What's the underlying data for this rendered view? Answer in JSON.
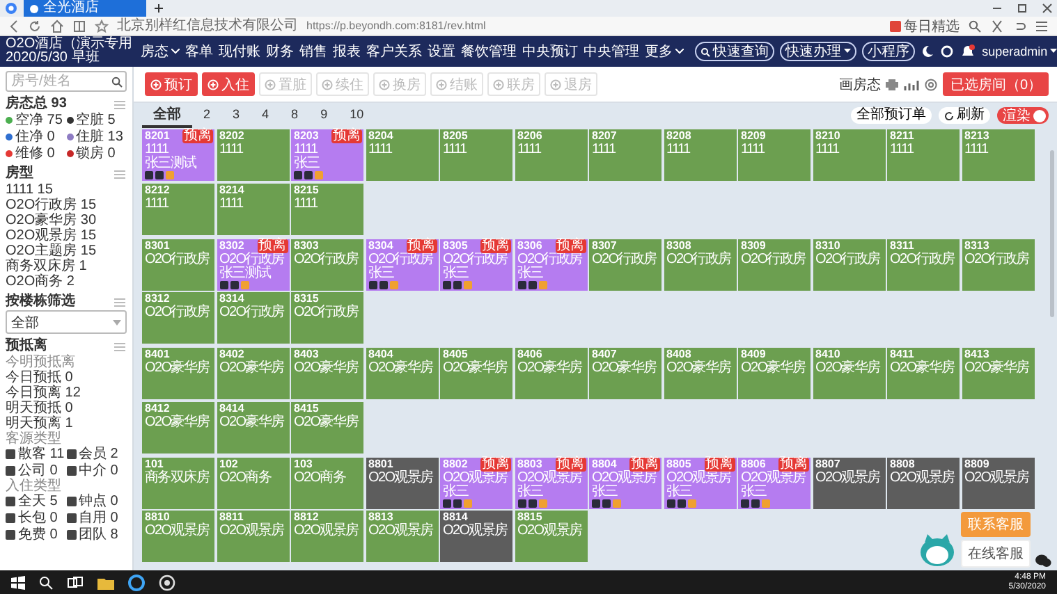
{
  "browser": {
    "tab_title": "全光酒店",
    "site_name": "北京别样红信息技术有限公司",
    "url": "https://p.beyondh.com:8181/rev.html",
    "extension_label": "每日精选"
  },
  "topbar": {
    "hotel_name": "O2O酒店（演示专用",
    "shift": "2020/5/30 早班",
    "menu": [
      {
        "label": "房态",
        "dropdown": true
      },
      {
        "label": "客单",
        "dropdown": false
      },
      {
        "label": "现付账",
        "dropdown": false
      },
      {
        "label": "财务",
        "dropdown": false
      },
      {
        "label": "销售",
        "dropdown": false
      },
      {
        "label": "报表",
        "dropdown": false
      },
      {
        "label": "客户关系",
        "dropdown": false
      },
      {
        "label": "设置",
        "dropdown": false
      },
      {
        "label": "餐饮管理",
        "dropdown": false
      },
      {
        "label": "中央预订",
        "dropdown": false
      },
      {
        "label": "中央管理",
        "dropdown": false
      },
      {
        "label": "更多",
        "dropdown": true
      }
    ],
    "quick": [
      {
        "label": "快速查询",
        "kind": "search"
      },
      {
        "label": "快速办理",
        "kind": "menu"
      },
      {
        "label": "小程序",
        "kind": "plain"
      }
    ],
    "user": "superadmin"
  },
  "sidebar": {
    "search": {
      "placeholder": "房号/姓名"
    },
    "sections": [
      {
        "kind": "status",
        "title": "房态总 93",
        "items": [
          {
            "label": "空净 75",
            "color": "#4caf50"
          },
          {
            "label": "空脏 5",
            "color": "#333333"
          },
          {
            "label": "住净 0",
            "color": "#2f6fd0"
          },
          {
            "label": "住脏 13",
            "color": "#8e7cc3"
          },
          {
            "label": "维修 0",
            "color": "#e53935"
          },
          {
            "label": "锁房 0",
            "color": "#c62828"
          }
        ]
      },
      {
        "kind": "list",
        "title": "房型",
        "items": [
          "1111 15",
          "O2O行政房 15",
          "O2O豪华房 30",
          "O2O观景房 15",
          "O2O主题房 15",
          "商务双床房 1",
          "O2O商务 2"
        ]
      },
      {
        "kind": "select",
        "title": "按楼栋筛选",
        "value": "全部"
      },
      {
        "kind": "groups",
        "title": "预抵离",
        "groups": [
          {
            "kind": "plain",
            "subtitle": "今明预抵离",
            "items": [
              "今日预抵 0",
              "今日预离 12",
              "明天预抵 0",
              "明天预离 1"
            ]
          },
          {
            "kind": "tagged",
            "subtitle": "客源类型",
            "items": [
              "散客 11",
              "会员 2",
              "公司 0",
              "中介 0"
            ]
          },
          {
            "kind": "tagged",
            "subtitle": "入住类型",
            "items": [
              "全天 5",
              "钟点 0",
              "长包 0",
              "自用 0",
              "免费 0",
              "团队 8"
            ]
          }
        ]
      }
    ]
  },
  "toolbar": {
    "buttons": [
      {
        "label": "预订",
        "kind": "primary",
        "disabled": false
      },
      {
        "label": "入住",
        "kind": "primary",
        "disabled": false
      },
      {
        "label": "置脏",
        "kind": "plain",
        "disabled": true
      },
      {
        "label": "续住",
        "kind": "plain",
        "disabled": true
      },
      {
        "label": "换房",
        "kind": "plain",
        "disabled": true
      },
      {
        "label": "结账",
        "kind": "plain",
        "disabled": true
      },
      {
        "label": "联房",
        "kind": "plain",
        "disabled": true
      },
      {
        "label": "退房",
        "kind": "plain",
        "disabled": true
      }
    ],
    "view_label": "画房态",
    "selected_button": "已选房间（0）"
  },
  "floor_tabs": [
    {
      "label": "全部",
      "selected": true
    },
    {
      "label": "2",
      "selected": false
    },
    {
      "label": "3",
      "selected": false
    },
    {
      "label": "4",
      "selected": false
    },
    {
      "label": "8",
      "selected": false
    },
    {
      "label": "9",
      "selected": false
    },
    {
      "label": "10",
      "selected": false
    }
  ],
  "view_options": {
    "expand_label": "全部预订单",
    "refresh_label": "刷新",
    "toggle": {
      "label": "渲染",
      "on": true
    }
  },
  "floors": [
    {
      "rows": [
        [
          {
            "number": "8201",
            "type": "1111",
            "kind": "occupied",
            "guest": "张三测试",
            "badge": "预离"
          },
          {
            "number": "8202",
            "type": "1111",
            "kind": "vacant"
          },
          {
            "number": "8203",
            "type": "1111",
            "kind": "occupied",
            "guest": "张三",
            "badge": "预离"
          },
          {
            "number": "8204",
            "type": "1111",
            "kind": "vacant"
          },
          {
            "number": "8205",
            "type": "1111",
            "kind": "vacant"
          },
          {
            "number": "8206",
            "type": "1111",
            "kind": "vacant"
          },
          {
            "number": "8207",
            "type": "1111",
            "kind": "vacant"
          },
          {
            "number": "8208",
            "type": "1111",
            "kind": "vacant"
          },
          {
            "number": "8209",
            "type": "1111",
            "kind": "vacant"
          },
          {
            "number": "8210",
            "type": "1111",
            "kind": "vacant"
          },
          {
            "number": "8211",
            "type": "1111",
            "kind": "vacant"
          },
          {
            "number": "8213",
            "type": "1111",
            "kind": "vacant"
          }
        ],
        [
          {
            "number": "8212",
            "type": "1111",
            "kind": "vacant"
          },
          {
            "number": "8214",
            "type": "1111",
            "kind": "vacant"
          },
          {
            "number": "8215",
            "type": "1111",
            "kind": "vacant"
          }
        ]
      ]
    },
    {
      "rows": [
        [
          {
            "number": "8301",
            "type": "O2O行政房",
            "kind": "vacant"
          },
          {
            "number": "8302",
            "type": "O2O行政房",
            "kind": "occupied",
            "guest": "张三测试",
            "badge": "预离"
          },
          {
            "number": "8303",
            "type": "O2O行政房",
            "kind": "vacant"
          },
          {
            "number": "8304",
            "type": "O2O行政房",
            "kind": "occupied",
            "guest": "张三",
            "badge": "预离"
          },
          {
            "number": "8305",
            "type": "O2O行政房",
            "kind": "occupied",
            "guest": "张三",
            "badge": "预离"
          },
          {
            "number": "8306",
            "type": "O2O行政房",
            "kind": "occupied",
            "guest": "张三",
            "badge": "预离"
          },
          {
            "number": "8307",
            "type": "O2O行政房",
            "kind": "vacant"
          },
          {
            "number": "8308",
            "type": "O2O行政房",
            "kind": "vacant"
          },
          {
            "number": "8309",
            "type": "O2O行政房",
            "kind": "vacant"
          },
          {
            "number": "8310",
            "type": "O2O行政房",
            "kind": "vacant"
          },
          {
            "number": "8311",
            "type": "O2O行政房",
            "kind": "vacant"
          },
          {
            "number": "8313",
            "type": "O2O行政房",
            "kind": "vacant"
          }
        ],
        [
          {
            "number": "8312",
            "type": "O2O行政房",
            "kind": "vacant"
          },
          {
            "number": "8314",
            "type": "O2O行政房",
            "kind": "vacant"
          },
          {
            "number": "8315",
            "type": "O2O行政房",
            "kind": "vacant"
          }
        ]
      ]
    },
    {
      "rows": [
        [
          {
            "number": "8401",
            "type": "O2O豪华房",
            "kind": "vacant"
          },
          {
            "number": "8402",
            "type": "O2O豪华房",
            "kind": "vacant"
          },
          {
            "number": "8403",
            "type": "O2O豪华房",
            "kind": "vacant"
          },
          {
            "number": "8404",
            "type": "O2O豪华房",
            "kind": "vacant"
          },
          {
            "number": "8405",
            "type": "O2O豪华房",
            "kind": "vacant"
          },
          {
            "number": "8406",
            "type": "O2O豪华房",
            "kind": "vacant"
          },
          {
            "number": "8407",
            "type": "O2O豪华房",
            "kind": "vacant"
          },
          {
            "number": "8408",
            "type": "O2O豪华房",
            "kind": "vacant"
          },
          {
            "number": "8409",
            "type": "O2O豪华房",
            "kind": "vacant"
          },
          {
            "number": "8410",
            "type": "O2O豪华房",
            "kind": "vacant"
          },
          {
            "number": "8411",
            "type": "O2O豪华房",
            "kind": "vacant"
          },
          {
            "number": "8413",
            "type": "O2O豪华房",
            "kind": "vacant"
          }
        ],
        [
          {
            "number": "8412",
            "type": "O2O豪华房",
            "kind": "vacant"
          },
          {
            "number": "8414",
            "type": "O2O豪华房",
            "kind": "vacant"
          },
          {
            "number": "8415",
            "type": "O2O豪华房",
            "kind": "vacant"
          }
        ]
      ]
    },
    {
      "rows": [
        [
          {
            "number": "101",
            "type": "商务双床房",
            "kind": "vacant"
          },
          {
            "number": "102",
            "type": "O2O商务",
            "kind": "vacant"
          },
          {
            "number": "103",
            "type": "O2O商务",
            "kind": "vacant"
          },
          {
            "number": "8801",
            "type": "O2O观景房",
            "kind": "dirty"
          },
          {
            "number": "8802",
            "type": "O2O观景房",
            "kind": "occupied",
            "guest": "张三",
            "badge": "预离"
          },
          {
            "number": "8803",
            "type": "O2O观景房",
            "kind": "occupied",
            "guest": "张三",
            "badge": "预离"
          },
          {
            "number": "8804",
            "type": "O2O观景房",
            "kind": "occupied",
            "guest": "张三",
            "badge": "预离"
          },
          {
            "number": "8805",
            "type": "O2O观景房",
            "kind": "occupied",
            "guest": "张三",
            "badge": "预离"
          },
          {
            "number": "8806",
            "type": "O2O观景房",
            "kind": "occupied",
            "guest": "张三",
            "badge": "预离"
          },
          {
            "number": "8807",
            "type": "O2O观景房",
            "kind": "dirty"
          },
          {
            "number": "8808",
            "type": "O2O观景房",
            "kind": "dirty"
          },
          {
            "number": "8809",
            "type": "O2O观景房",
            "kind": "dirty"
          }
        ],
        [
          {
            "number": "8810",
            "type": "O2O观景房",
            "kind": "vacant"
          },
          {
            "number": "8811",
            "type": "O2O观景房",
            "kind": "vacant"
          },
          {
            "number": "8812",
            "type": "O2O观景房",
            "kind": "vacant"
          },
          {
            "number": "8813",
            "type": "O2O观景房",
            "kind": "vacant"
          },
          {
            "number": "8814",
            "type": "O2O观景房",
            "kind": "dirty"
          },
          {
            "number": "8815",
            "type": "O2O观景房",
            "kind": "vacant"
          }
        ]
      ]
    }
  ],
  "service": {
    "contact": "联系客服",
    "online": "在线客服"
  },
  "taskbar": {
    "time": "4:48 PM",
    "date": "5/30/2020"
  }
}
